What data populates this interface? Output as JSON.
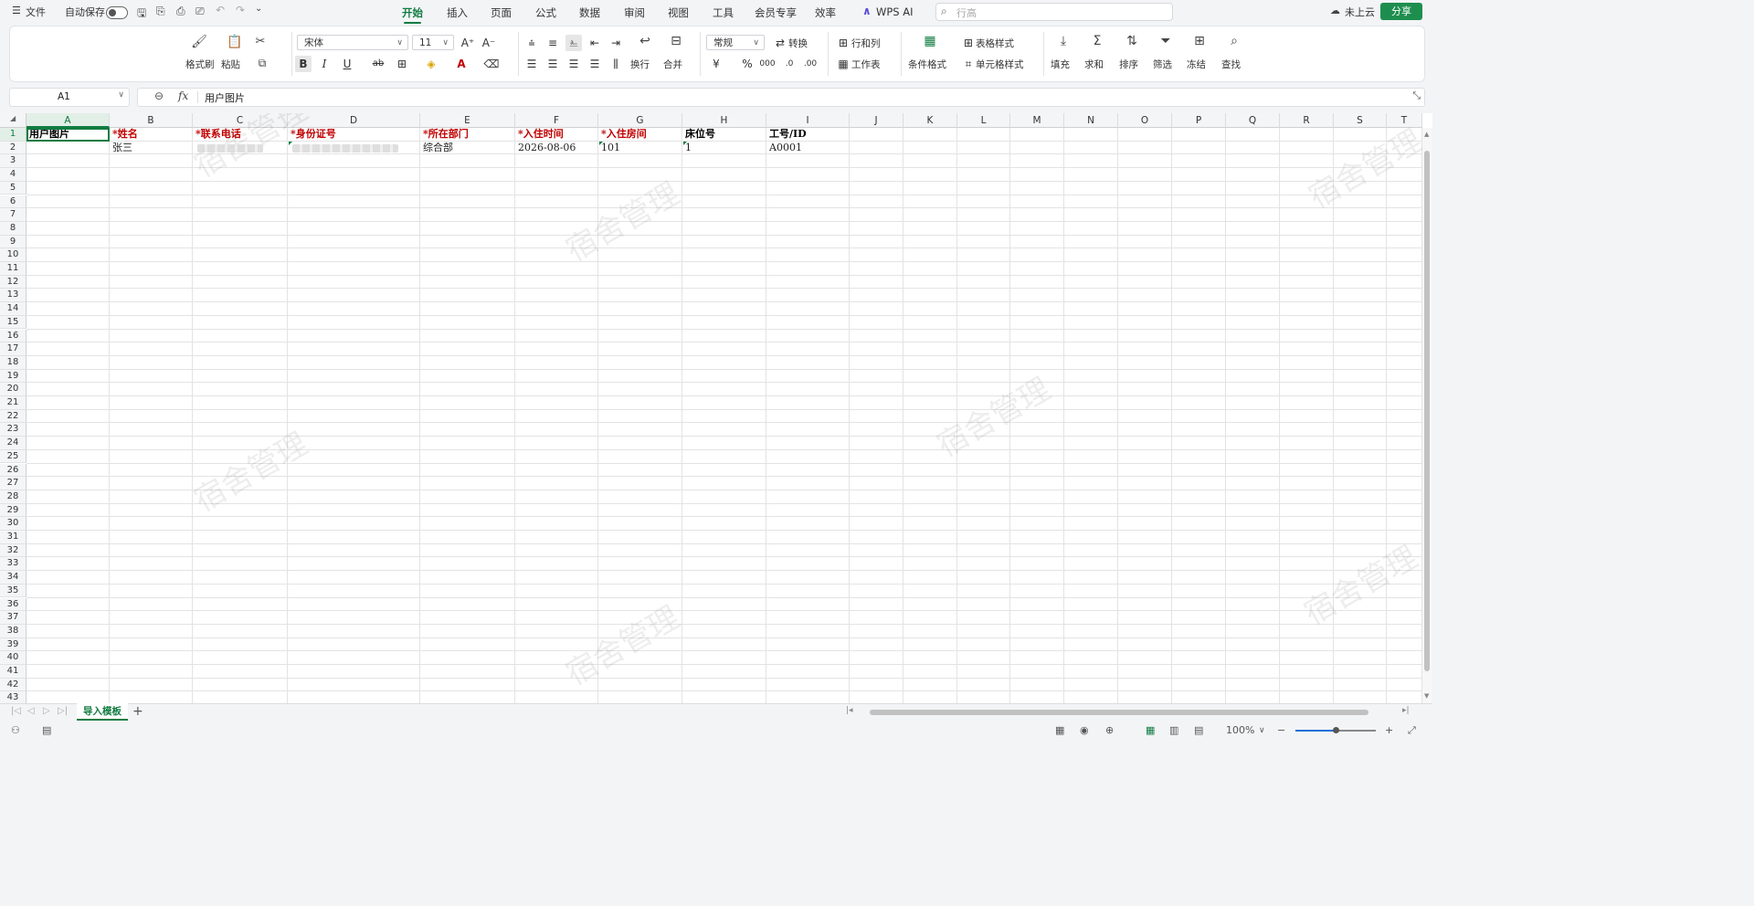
{
  "topbar": {
    "file_menu": "文件",
    "autosave_label": "自动保存",
    "tabs": [
      "开始",
      "插入",
      "页面",
      "公式",
      "数据",
      "审阅",
      "视图",
      "工具",
      "会员专享",
      "效率"
    ],
    "active_tab": "开始",
    "ai_label": "WPS AI",
    "search_placeholder": "行高",
    "cloud_status": "未上云",
    "share_label": "分享"
  },
  "ribbon": {
    "format_painter": "格式刷",
    "paste": "粘贴",
    "font_name": "宋体",
    "font_size": "11",
    "wrap": "换行",
    "merge": "合并",
    "number_format": "常规",
    "convert": "转换",
    "rows_cols": "行和列",
    "worksheet": "工作表",
    "cond_format": "条件格式",
    "table_style": "表格样式",
    "cell_style": "单元格样式",
    "fill": "填充",
    "sum": "求和",
    "sort": "排序",
    "filter": "筛选",
    "freeze": "冻结",
    "find": "查找",
    "bold": "B",
    "italic": "I",
    "underline": "U",
    "percent": "%"
  },
  "formula_bar": {
    "name_box": "A1",
    "fx": "fx",
    "content": "用户图片"
  },
  "columns": [
    "A",
    "B",
    "C",
    "D",
    "E",
    "F",
    "G",
    "H",
    "I",
    "J",
    "K",
    "L",
    "M",
    "N",
    "O",
    "P",
    "Q",
    "R",
    "S",
    "T"
  ],
  "rows": [
    "1",
    "2",
    "3",
    "4",
    "5",
    "6",
    "7",
    "8",
    "9",
    "10",
    "11",
    "12",
    "13",
    "14",
    "15",
    "16",
    "17",
    "18",
    "19",
    "20",
    "21",
    "22",
    "23",
    "24",
    "25",
    "26",
    "27",
    "28",
    "29",
    "30",
    "31",
    "32",
    "33",
    "34",
    "35",
    "36",
    "37",
    "38",
    "39",
    "40",
    "41",
    "42",
    "43"
  ],
  "cells": {
    "A1": "用户图片",
    "B1": "*姓名",
    "C1": "*联系电话",
    "D1": "*身份证号",
    "E1": "*所在部门",
    "F1": "*入住时间",
    "G1": "*入住房间",
    "H1": "床位号",
    "I1": "工号/ID",
    "B2": "张三",
    "E2": "综合部",
    "F2": "2026-08-06",
    "G2": "101",
    "H2": "1",
    "I2": "A0001"
  },
  "watermark": "宿舍管理",
  "sheet_tabs": [
    "导入模板"
  ],
  "status": {
    "zoom": "100%"
  },
  "colors": {
    "accent": "#107c41",
    "required_header": "#c00000"
  }
}
